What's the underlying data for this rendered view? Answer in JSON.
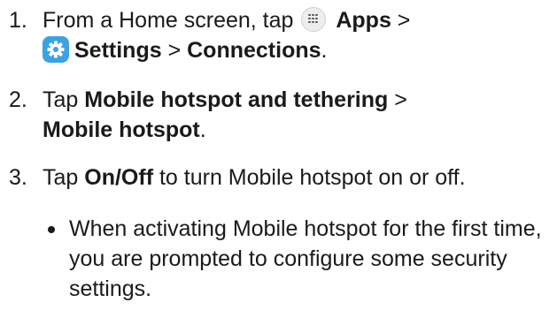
{
  "steps": [
    {
      "number": "1.",
      "before_apps": "From a Home screen, tap",
      "apps_label": "Apps",
      "sep1": " >",
      "settings_label": "Settings",
      "sep2": " > ",
      "connections_label": "Connections",
      "end": "."
    },
    {
      "number": "2.",
      "prefix": "Tap ",
      "hotspot_tethering_label": "Mobile hotspot and tethering",
      "sep": " >",
      "hotspot_label": "Mobile hotspot",
      "end": "."
    },
    {
      "number": "3.",
      "prefix": "Tap ",
      "onoff_label": "On/Off",
      "suffix": " to turn Mobile hotspot on or off."
    }
  ],
  "bullet": {
    "text": "When activating Mobile hotspot for the first time, you are prompted to configure some security settings."
  },
  "icons": {
    "apps": "apps-grid-icon",
    "settings": "settings-gear-icon",
    "settings_color": "#3aa3e3"
  }
}
